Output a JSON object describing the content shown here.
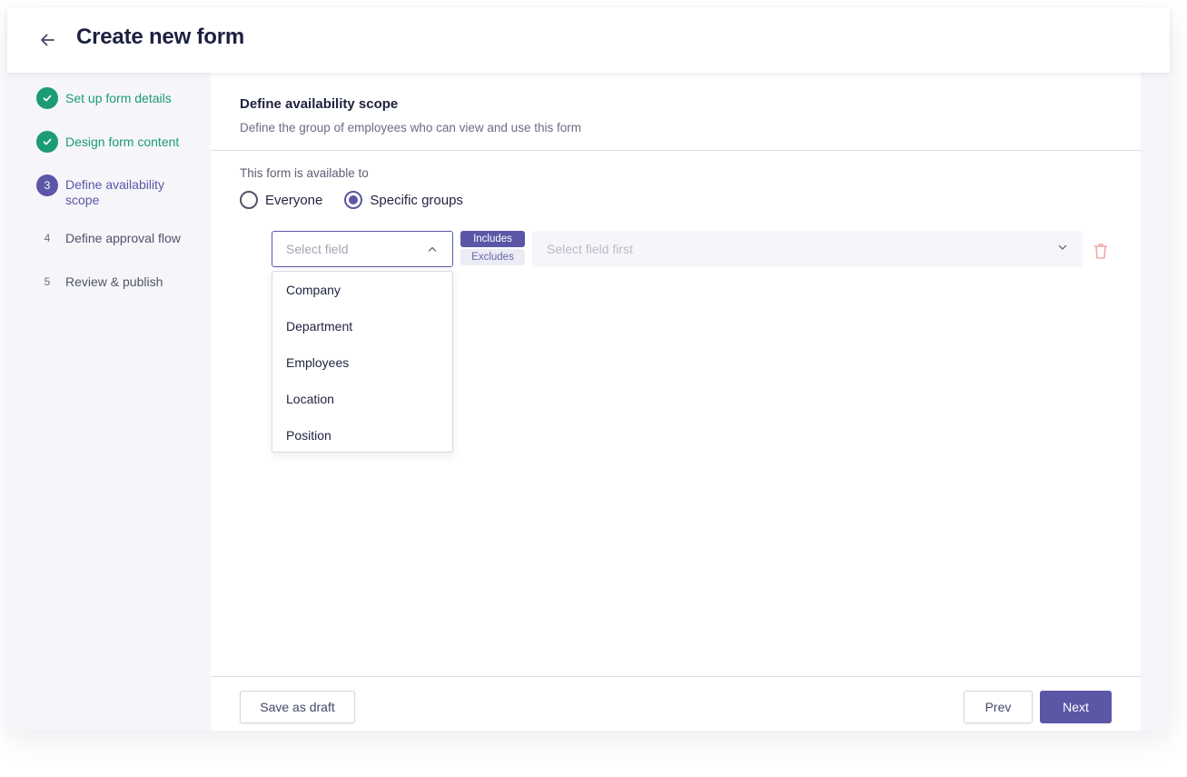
{
  "header": {
    "title": "Create new form",
    "back_icon": "arrow-left-icon"
  },
  "stepper": {
    "steps": [
      {
        "label": "Set up form details",
        "state": "done",
        "marker": "check-icon"
      },
      {
        "label": "Design form content",
        "state": "done",
        "marker": "check-icon"
      },
      {
        "label": "Define availability scope",
        "state": "current",
        "marker": "3"
      },
      {
        "label": "Define approval flow",
        "state": "pending",
        "marker": "4"
      },
      {
        "label": "Review & publish",
        "state": "pending",
        "marker": "5"
      }
    ]
  },
  "main": {
    "title": "Define availability scope",
    "description": "Define the group of employees who can view and use this form",
    "availability_label": "This form is available to",
    "radio_options": [
      {
        "label": "Everyone",
        "checked": false
      },
      {
        "label": "Specific groups",
        "checked": true
      }
    ],
    "rule": {
      "field_placeholder": "Select field",
      "toggle": {
        "includes": "Includes",
        "excludes": "Excludes",
        "selected": "Includes"
      },
      "value_placeholder": "Select field first"
    },
    "dropdown_options": [
      "Company",
      "Department",
      "Employees",
      "Location",
      "Position"
    ]
  },
  "footer": {
    "save_draft": "Save as draft",
    "prev": "Prev",
    "next": "Next"
  },
  "colors": {
    "accent": "#5b57a6",
    "success": "#1c9c72",
    "danger": "#f2a5a9"
  }
}
